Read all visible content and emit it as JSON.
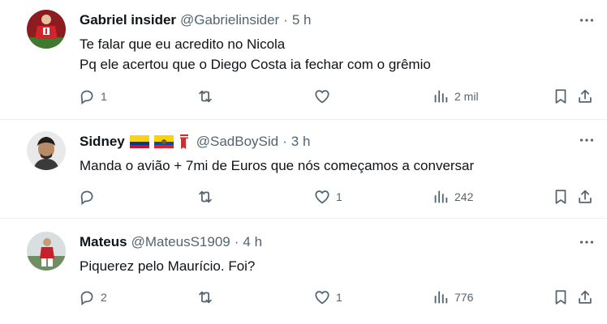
{
  "tweets": [
    {
      "name": "Gabriel insider",
      "handle": "@Gabrielinsider",
      "dot": "·",
      "time": "5 h",
      "lines": [
        "Te falar que eu acredito no Nicola",
        "Pq ele acertou que o Diego Costa ia fechar com o grêmio"
      ],
      "replies": "1",
      "retweets": "",
      "likes": "",
      "views": "2 mil"
    },
    {
      "name": "Sidney",
      "handle": "@SadBoySid",
      "dot": "·",
      "time": "3 h",
      "lines": [
        "Manda o avião + 7mi de Euros que nós começamos a conversar"
      ],
      "replies": "",
      "retweets": "",
      "likes": "1",
      "views": "242"
    },
    {
      "name": "Mateus",
      "handle": "@MateusS1909",
      "dot": "·",
      "time": "4 h",
      "lines": [
        "Piquerez pelo Maurício. Foi?"
      ],
      "replies": "2",
      "retweets": "",
      "likes": "1",
      "views": "776"
    }
  ],
  "colors": {
    "text": "#0f1419",
    "secondary": "#536471",
    "divider": "#eff3f4"
  },
  "icons": [
    "reply-icon",
    "retweet-icon",
    "like-icon",
    "views-icon",
    "bookmark-icon",
    "share-icon",
    "more-icon"
  ]
}
